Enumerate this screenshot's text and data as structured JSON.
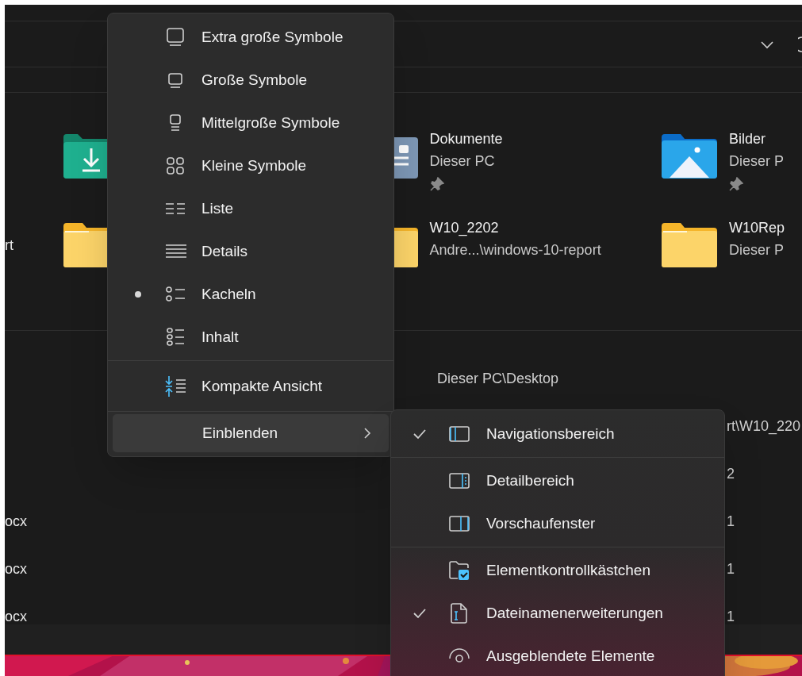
{
  "quick_access": [
    {
      "tiles": [
        {
          "kind": "downloads"
        },
        {
          "kind": "documents",
          "name": "Dokumente",
          "location": "Dieser PC",
          "pinned": true
        },
        {
          "kind": "pictures",
          "name": "Bilder",
          "location": "Dieser P",
          "pinned": true
        }
      ]
    },
    {
      "leading": "rt",
      "tiles": [
        {
          "kind": "folder"
        },
        {
          "kind": "folder",
          "name": "W10_2202",
          "location": "Andre...\\windows-10-report",
          "pinned": false
        },
        {
          "kind": "folder",
          "name": "W10Rep",
          "location": "Dieser P",
          "pinned": false
        }
      ]
    }
  ],
  "recent_files": [
    {
      "location": "Dieser PC\\Desktop"
    },
    {
      "column_3": "rt\\W10_220"
    },
    {
      "column_3": "2"
    },
    {
      "name": "ocx",
      "column_3": "1"
    },
    {
      "name": "ocx",
      "column_3": "1"
    },
    {
      "name": "ocx",
      "column_3": "1"
    }
  ],
  "view_menu": {
    "sections": [
      [
        {
          "kind": "option",
          "label": "Extra große Symbole",
          "selected": false
        },
        {
          "kind": "option",
          "label": "Große Symbole",
          "selected": false
        },
        {
          "kind": "option",
          "label": "Mittelgroße Symbole",
          "selected": false
        },
        {
          "kind": "option",
          "label": "Kleine Symbole",
          "selected": false
        },
        {
          "kind": "option",
          "label": "Liste",
          "selected": false
        },
        {
          "kind": "option",
          "label": "Details",
          "selected": false
        },
        {
          "kind": "option",
          "label": "Kacheln",
          "selected": true
        },
        {
          "kind": "option",
          "label": "Inhalt",
          "selected": false
        }
      ],
      [
        {
          "kind": "toggle",
          "label": "Kompakte Ansicht"
        }
      ],
      [
        {
          "kind": "submenu",
          "label": "Einblenden",
          "expanded": true
        }
      ]
    ]
  },
  "show_submenu": {
    "sections": [
      [
        {
          "label": "Navigationsbereich",
          "checked": true
        }
      ],
      [
        {
          "label": "Detailbereich",
          "checked": false
        },
        {
          "label": "Vorschaufenster",
          "checked": false
        }
      ],
      [
        {
          "label": "Elementkontrollkästchen",
          "checked": false
        },
        {
          "label": "Dateinamenerweiterungen",
          "checked": true
        },
        {
          "label": "Ausgeblendete Elemente",
          "checked": false
        }
      ]
    ]
  }
}
